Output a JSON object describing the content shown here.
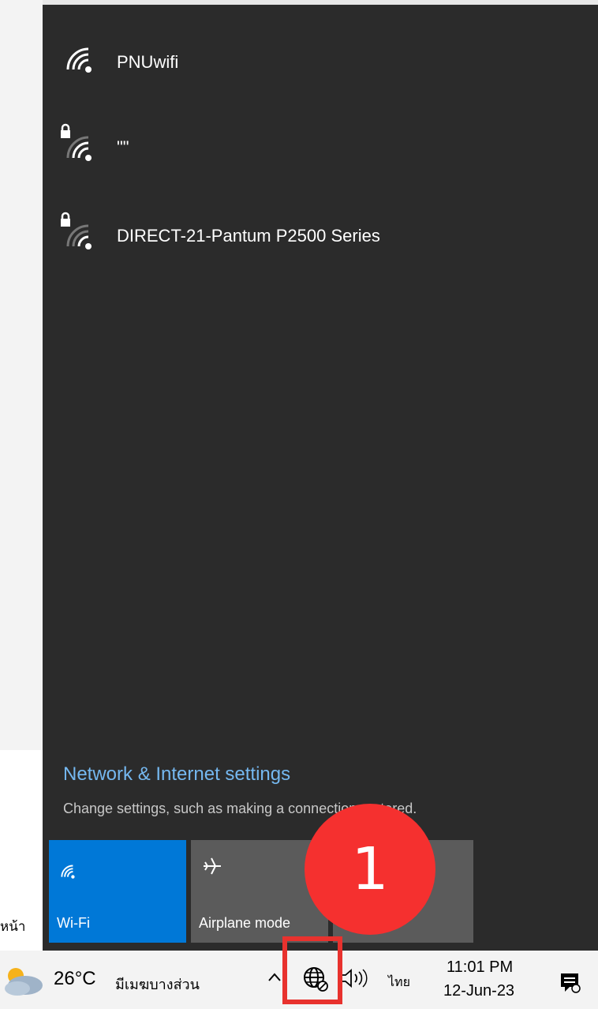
{
  "networks": [
    {
      "ssid": "PNUwifi",
      "secured": false
    },
    {
      "ssid": "\"\"",
      "secured": true
    },
    {
      "ssid": "DIRECT-21-Pantum P2500 Series",
      "secured": true
    }
  ],
  "settings": {
    "title": "Network & Internet settings",
    "subtitle": "Change settings, such as making a connection metered."
  },
  "tiles": {
    "wifi": {
      "label": "Wi-Fi",
      "active": true,
      "color": "#0078d7"
    },
    "airplane": {
      "label": "Airplane mode",
      "active": false
    },
    "third": {
      "label": ""
    }
  },
  "background_label": "หน้า",
  "taskbar": {
    "temperature": "26°C",
    "weather": "มีเมฆบางส่วน",
    "language": "ไทย",
    "time": "11:01 PM",
    "date": "12-Jun-23"
  },
  "annotation": {
    "step_number": "1",
    "color": "#f5302f"
  }
}
